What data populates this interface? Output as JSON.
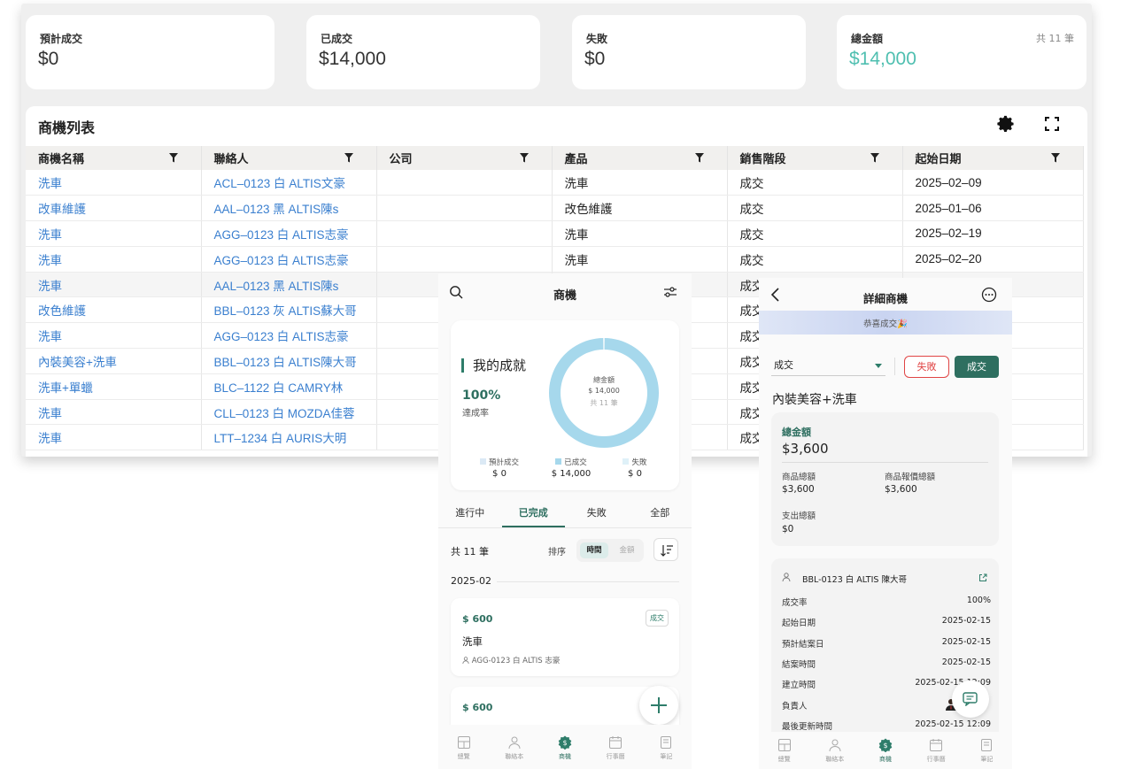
{
  "summary": {
    "expected": {
      "label": "預計成交",
      "value": "$0"
    },
    "won": {
      "label": "已成交",
      "value": "$14,000"
    },
    "lost": {
      "label": "失敗",
      "value": "$0"
    },
    "total": {
      "label": "總金額",
      "value": "$14,000",
      "count": "共 11 筆"
    }
  },
  "table": {
    "title": "商機列表",
    "columns": [
      "商機名稱",
      "聯絡人",
      "公司",
      "產品",
      "銷售階段",
      "起始日期"
    ],
    "rows": [
      [
        "洗車",
        "ACL–0123 白 ALTIS文豪",
        "",
        "洗車",
        "成交",
        "2025–02–09"
      ],
      [
        "改車維護",
        "AAL–0123 黑 ALTIS陳s",
        "",
        "改色維護",
        "成交",
        "2025–01–06"
      ],
      [
        "洗車",
        "AGG–0123 白 ALTIS志豪",
        "",
        "洗車",
        "成交",
        "2025–02–19"
      ],
      [
        "洗車",
        "AGG–0123 白 ALTIS志豪",
        "",
        "洗車",
        "成交",
        "2025–02–20"
      ],
      [
        "洗車",
        "AAL–0123 黑 ALTIS陳s",
        "",
        "",
        "成交",
        ""
      ],
      [
        "改色維護",
        "BBL–0123 灰 ALTIS蘇大哥",
        "",
        "",
        "成交",
        ""
      ],
      [
        "洗車",
        "AGG–0123 白 ALTIS志豪",
        "",
        "",
        "成交",
        ""
      ],
      [
        "內裝美容+洗車",
        "BBL–0123 白 ALTIS陳大哥",
        "",
        "",
        "成交",
        ""
      ],
      [
        "洗車+單蠟",
        "BLC–1122 白 CAMRY林",
        "",
        "",
        "成交",
        ""
      ],
      [
        "洗車",
        "CLL–0123 白 MOZDA佳蓉",
        "",
        "",
        "成交",
        ""
      ],
      [
        "洗車",
        "LTT–1234 白 AURIS大明",
        "",
        "",
        "成交",
        ""
      ]
    ]
  },
  "phone1": {
    "title": "商機",
    "achievement": {
      "title": "我的成就",
      "rate": "100%",
      "rate_label": "達成率"
    },
    "donut": {
      "label": "總金額",
      "value": "$ 14,000",
      "count": "共 11 筆"
    },
    "legend": [
      {
        "name": "預計成交",
        "value": "$ 0",
        "color": "#dbe9f5"
      },
      {
        "name": "已成交",
        "value": "$ 14,000",
        "color": "#a6d8ec"
      },
      {
        "name": "失敗",
        "value": "$ 0",
        "color": "#dff1f8"
      }
    ],
    "chart_data": {
      "type": "pie",
      "categories": [
        "預計成交",
        "已成交",
        "失敗"
      ],
      "values": [
        0,
        14000,
        0
      ]
    },
    "tabs": [
      "進行中",
      "已完成",
      "失敗",
      "全部"
    ],
    "count": "共 11 筆",
    "sort_label": "排序",
    "sort_time": "時間",
    "sort_amount": "金額",
    "month": "2025-02",
    "deals": [
      {
        "amount": "$ 600",
        "badge": "成交",
        "name": "洗車",
        "contact": "AGG-0123 白 ALTIS 志豪"
      },
      {
        "amount": "$ 600"
      }
    ]
  },
  "tabbar": [
    "總覽",
    "聯絡本",
    "商機",
    "行事曆",
    "筆記"
  ],
  "phone2": {
    "title": "詳細商機",
    "banner": "恭喜成交🎉",
    "stage": "成交",
    "fail_btn": "失敗",
    "win_btn": "成交",
    "name": "內裝美容+洗車",
    "total_label": "總金額",
    "total_value": "$3,600",
    "product_total_label": "商品總額",
    "product_total_value": "$3,600",
    "quote_total_label": "商品報價總額",
    "quote_total_value": "$3,600",
    "expense_label": "支出總額",
    "expense_value": "$0",
    "contact": "BBL-0123 白 ALTIS 陳大哥",
    "details": [
      {
        "k": "成交率",
        "v": "100%"
      },
      {
        "k": "起始日期",
        "v": "2025-02-15"
      },
      {
        "k": "預計結案日",
        "v": "2025-02-15"
      },
      {
        "k": "結案時間",
        "v": "2025-02-15"
      },
      {
        "k": "建立時間",
        "v": "2025-02-15 12:09"
      },
      {
        "k": "負責人",
        "v": ""
      },
      {
        "k": "最後更新時間",
        "v": "2025-02-15 12:09"
      }
    ]
  }
}
